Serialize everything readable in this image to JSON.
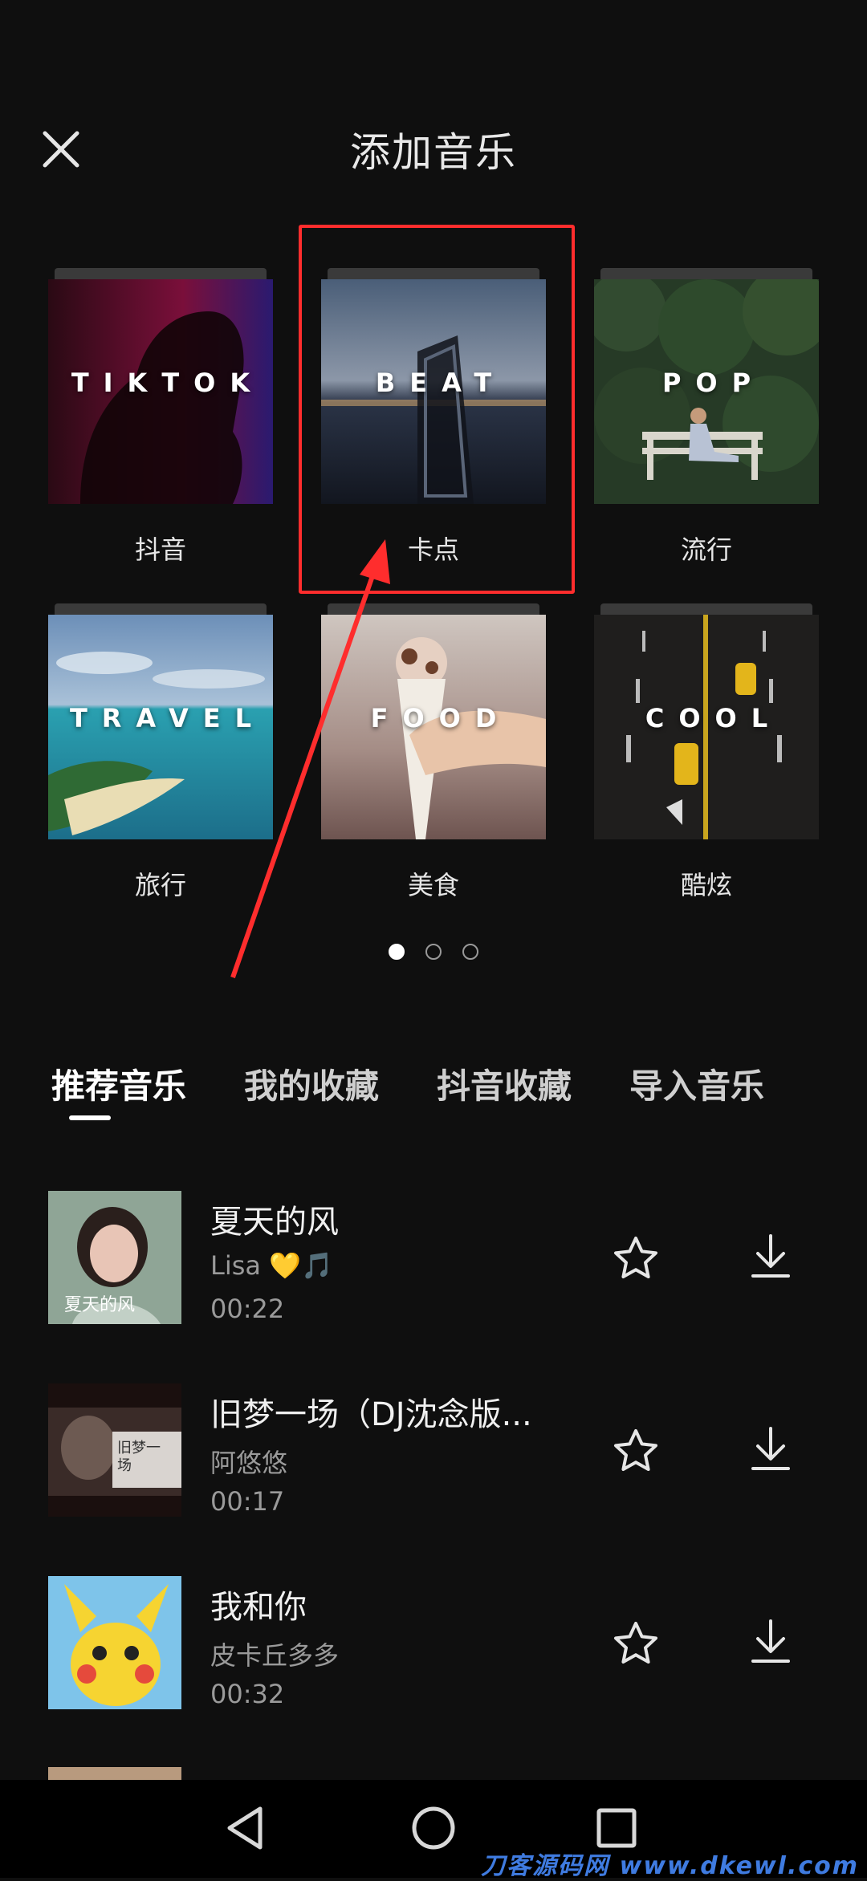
{
  "header": {
    "title": "添加音乐"
  },
  "categories": [
    {
      "cover_text": "TIKTOK",
      "label": "抖音"
    },
    {
      "cover_text": "BEAT",
      "label": "卡点"
    },
    {
      "cover_text": "POP",
      "label": "流行"
    },
    {
      "cover_text": "TRAVEL",
      "label": "旅行"
    },
    {
      "cover_text": "FOOD",
      "label": "美食"
    },
    {
      "cover_text": "COOL",
      "label": "酷炫"
    }
  ],
  "pagination": {
    "pages": 3,
    "active": 1
  },
  "tabs": [
    {
      "label": "推荐音乐",
      "active": true
    },
    {
      "label": "我的收藏",
      "active": false
    },
    {
      "label": "抖音收藏",
      "active": false
    },
    {
      "label": "导入音乐",
      "active": false
    }
  ],
  "music": [
    {
      "name": "夏天的风",
      "artist": "Lisa 💛🎵",
      "duration": "00:22",
      "thumb_text": "夏天的风"
    },
    {
      "name": "旧梦一场（DJ沈念版...",
      "artist": "阿悠悠",
      "duration": "00:17",
      "thumb_text": "旧梦一场"
    },
    {
      "name": "我和你",
      "artist": "皮卡丘多多",
      "duration": "00:32",
      "thumb_text": ""
    }
  ],
  "icons": {
    "close": "close-icon",
    "favorite": "star-icon",
    "download": "download-icon",
    "nav_back": "back-triangle-icon",
    "nav_home": "home-circle-icon",
    "nav_recent": "recent-square-icon"
  },
  "colors": {
    "accent_highlight": "#ff2d2d",
    "background": "#0f0f0f"
  },
  "watermark": "刀客源码网 www.dkewl.com"
}
